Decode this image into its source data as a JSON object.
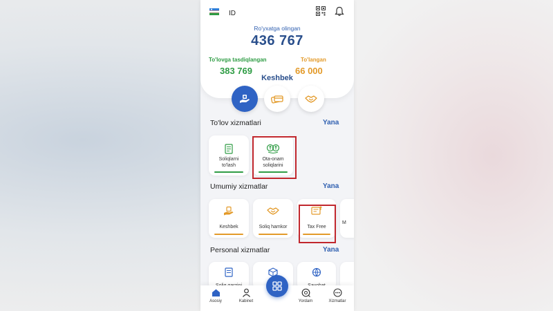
{
  "header": {
    "id_label": "ID",
    "registered_label": "Ro'yxatga olingan",
    "registered_value": "436 767",
    "confirmed_label": "To'lovga tasdiqlangan",
    "confirmed_value": "383 769",
    "paid_label": "To'langan",
    "paid_value": "66 000",
    "keshbek_label": "Keshbek"
  },
  "sections": {
    "payment": {
      "title": "To'lov xizmatlari",
      "more": "Yana"
    },
    "general": {
      "title": "Umumiy xizmatlar",
      "more": "Yana"
    },
    "personal": {
      "title": "Personal xizmatlar",
      "more": "Yana"
    }
  },
  "payment_cards": [
    {
      "label_line1": "Soliqlarni",
      "label_line2": "to'lash",
      "icon": "document-icon"
    },
    {
      "label_line1": "Ota-onam",
      "label_line2": "soliqlarini",
      "icon": "parents-coin-icon"
    }
  ],
  "general_cards": [
    {
      "label": "Keshbek",
      "icon": "cashback-icon"
    },
    {
      "label": "Soliq hamkor",
      "icon": "handshake-icon"
    },
    {
      "label": "Tax Free",
      "icon": "tax-free-icon"
    },
    {
      "label": "M",
      "icon": ""
    }
  ],
  "personal_cards": [
    {
      "label": "Soliq qarzini",
      "icon": "tax-debt-icon"
    },
    {
      "label": "",
      "icon": "box-icon"
    },
    {
      "label": "Sayohat",
      "icon": "travel-icon"
    },
    {
      "label": "",
      "icon": ""
    }
  ],
  "nav": [
    {
      "label": "Asosiy",
      "icon": "home-icon"
    },
    {
      "label": "Kabinet",
      "icon": "user-icon"
    },
    {
      "label": "Yordam",
      "icon": "help-icon"
    },
    {
      "label": "Xizmatlar",
      "icon": "services-icon"
    }
  ],
  "colors": {
    "primary": "#2f63c4",
    "dark_blue": "#2a4f8c",
    "green": "#2e9c44",
    "orange": "#e39a29",
    "highlight": "#c1272d"
  }
}
